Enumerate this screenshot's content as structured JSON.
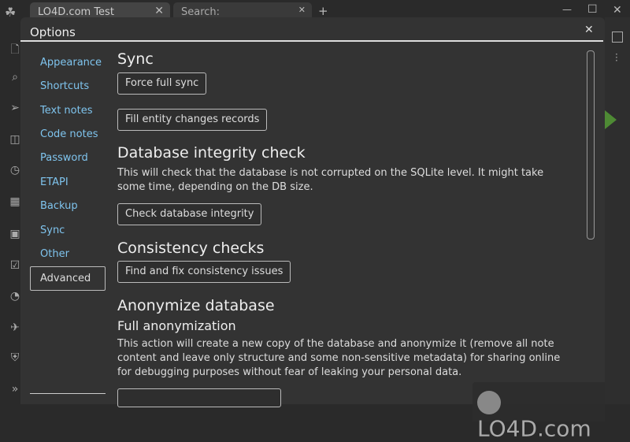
{
  "tabs": [
    {
      "label": "LO4D.com Test"
    },
    {
      "label": "Search:"
    }
  ],
  "window_controls": {
    "new_tab": "+",
    "minimize": "—",
    "maximize": "☐",
    "close": "✕"
  },
  "dialog": {
    "title": "Options",
    "close": "✕"
  },
  "nav": {
    "items": [
      "Appearance",
      "Shortcuts",
      "Text notes",
      "Code notes",
      "Password",
      "ETAPI",
      "Backup",
      "Sync",
      "Other",
      "Advanced"
    ],
    "active": "Advanced"
  },
  "content": {
    "sync_title": "Sync",
    "force_sync": "Force full sync",
    "fill_entity": "Fill entity changes records",
    "integrity_title": "Database integrity check",
    "integrity_desc": "This will check that the database is not corrupted on the SQLite level. It might take some time, depending on the DB size.",
    "check_integrity": "Check database integrity",
    "consistency_title": "Consistency checks",
    "find_fix": "Find and fix consistency issues",
    "anonymize_title": "Anonymize database",
    "full_anon_title": "Full anonymization",
    "anon_desc": "This action will create a new copy of the database and anonymize it (remove all note content and leave only structure and some non-sensitive metadata) for sharing online for debugging purposes without fear of leaking your personal data."
  },
  "watermark": "LO4D.com",
  "colors": {
    "accent_link": "#7fc4ee",
    "run_button": "#4e8a34"
  }
}
